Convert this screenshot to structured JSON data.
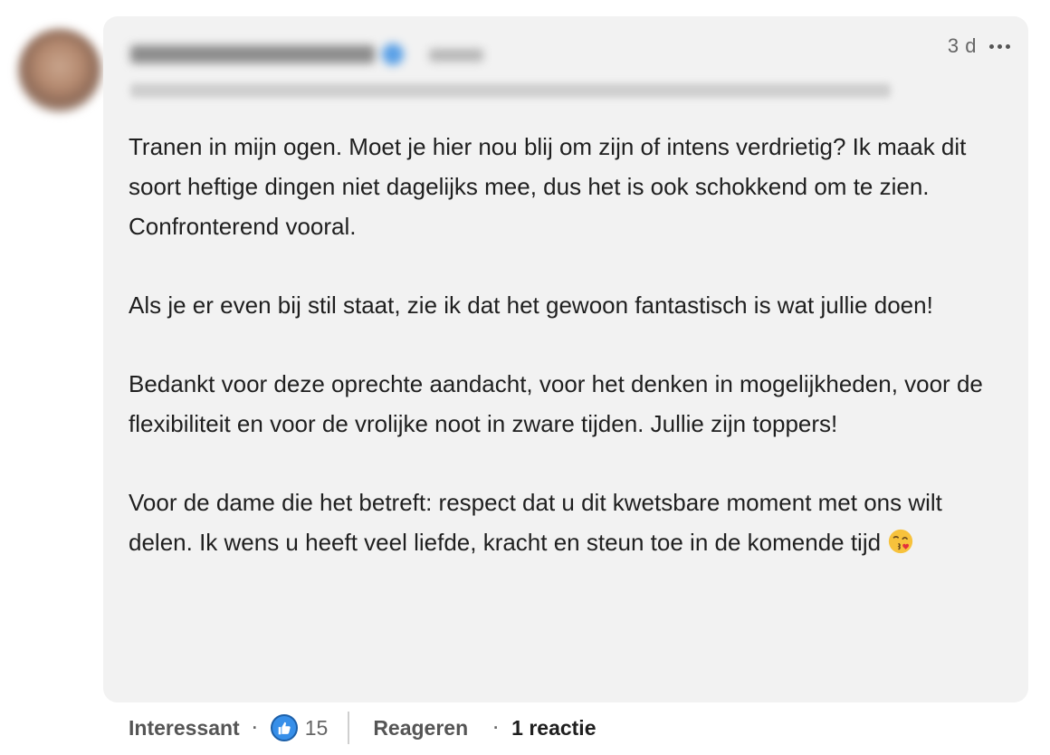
{
  "comment": {
    "timestamp": "3 d",
    "paragraphs": [
      "Tranen in mijn ogen. Moet je hier nou blij om zijn of intens verdrietig? Ik maak dit soort heftige dingen niet dagelijks mee, dus het is ook schokkend om te zien. Confronterend vooral.",
      "Als je er even bij stil staat, zie ik dat het gewoon fantastisch is wat jullie doen!",
      "Bedankt voor deze oprechte aandacht, voor het denken in mogelijkheden, voor de flexibiliteit en voor de vrolijke noot in zware tijden. Jullie zijn toppers!",
      "Voor de dame die het betreft: respect dat u dit kwetsbare moment met ons wilt delen. Ik wens u heeft veel liefde, kracht en steun toe in de komende tijd"
    ],
    "emoji": "face-blowing-kiss-icon"
  },
  "actions": {
    "react_label": "Interessant",
    "reaction_count": "15",
    "reply_label": "Reageren",
    "reply_count": "1 reactie"
  },
  "colors": {
    "bubble": "#f2f2f2",
    "like_blue": "#378fe9"
  }
}
